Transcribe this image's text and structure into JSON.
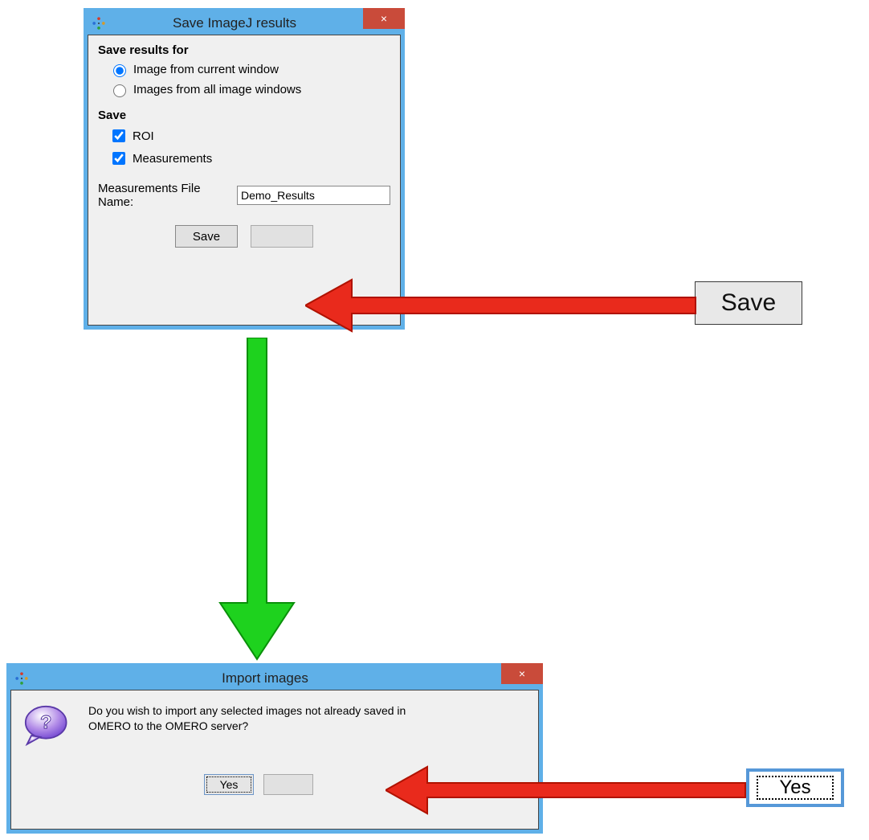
{
  "dialog1": {
    "title": "Save ImageJ results",
    "close_icon": "×",
    "section1_heading": "Save results for",
    "radio_current_label": "Image from current window",
    "radio_all_label": "Images from all image windows",
    "section2_heading": "Save",
    "check_roi_label": "ROI",
    "check_meas_label": "Measurements",
    "filename_label": "Measurements File Name:",
    "filename_value": "Demo_Results",
    "save_btn": "Save"
  },
  "dialog2": {
    "title": "Import images",
    "close_icon": "×",
    "message": "Do you wish to import any selected images not already saved in OMERO to the OMERO server?",
    "yes_btn": "Yes"
  },
  "callouts": {
    "save_label": "Save",
    "yes_label": "Yes"
  }
}
